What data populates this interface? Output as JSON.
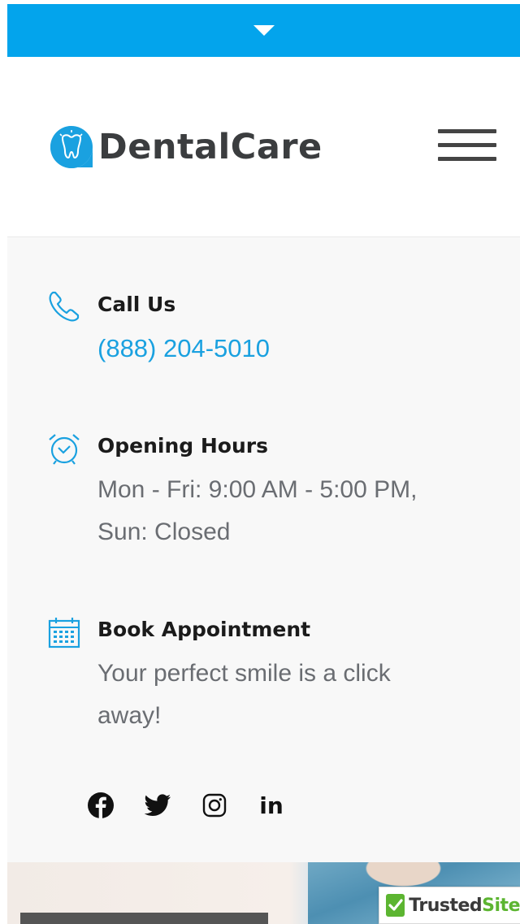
{
  "top_bar": {
    "toggle_icon": "caret-down-icon",
    "color": "#03a4ec"
  },
  "header": {
    "logo": {
      "mark_icon": "tooth-icon",
      "text": "DentalCare",
      "mark_color": "#1aa1e0",
      "text_color": "#3b3d3f"
    },
    "menu_icon": "hamburger-menu-icon"
  },
  "contact": {
    "call": {
      "icon": "phone-icon",
      "title": "Call Us",
      "phone": "(888) 204-5010"
    },
    "hours": {
      "icon": "alarm-clock-icon",
      "title": "Opening Hours",
      "text": "Mon - Fri: 9:00 AM - 5:00 PM, Sun: Closed"
    },
    "appointment": {
      "icon": "calendar-icon",
      "title": "Book Appointment",
      "text": "Your perfect smile is a click away!"
    }
  },
  "social": [
    {
      "icon": "facebook-icon"
    },
    {
      "icon": "twitter-icon"
    },
    {
      "icon": "instagram-icon"
    },
    {
      "icon": "linkedin-icon",
      "label": "in"
    }
  ],
  "badge": {
    "icon": "checkmark-icon",
    "text_1": "Trusted",
    "text_2": "Site"
  },
  "accent_color": "#1aa1e0"
}
